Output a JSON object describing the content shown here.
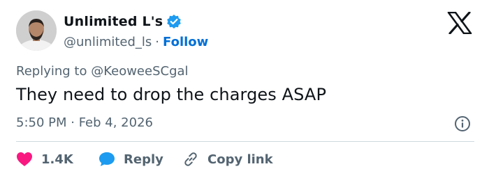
{
  "tweet": {
    "author": {
      "display_name": "Unlimited L's",
      "handle": "@unlimited_ls",
      "separator": "·",
      "follow_label": "Follow"
    },
    "replying_to_prefix": "Replying to",
    "replying_to_handle": "@KeoweeSCgal",
    "text": "They need to drop the charges ASAP",
    "timestamp": "5:50 PM · Feb 4, 2026",
    "actions": {
      "like_count": "1.4K",
      "reply_label": "Reply",
      "copy_link_label": "Copy link"
    }
  },
  "colors": {
    "verified_badge": "#1d9bf0",
    "follow_link": "#006fd6",
    "like_heart": "#f91880",
    "reply_bubble": "#1d9bf0",
    "secondary_text": "#536471",
    "primary_text": "#0f1419"
  },
  "icons": [
    "verified-badge-icon",
    "x-logo-icon",
    "info-icon",
    "heart-icon",
    "reply-bubble-icon",
    "link-icon"
  ]
}
